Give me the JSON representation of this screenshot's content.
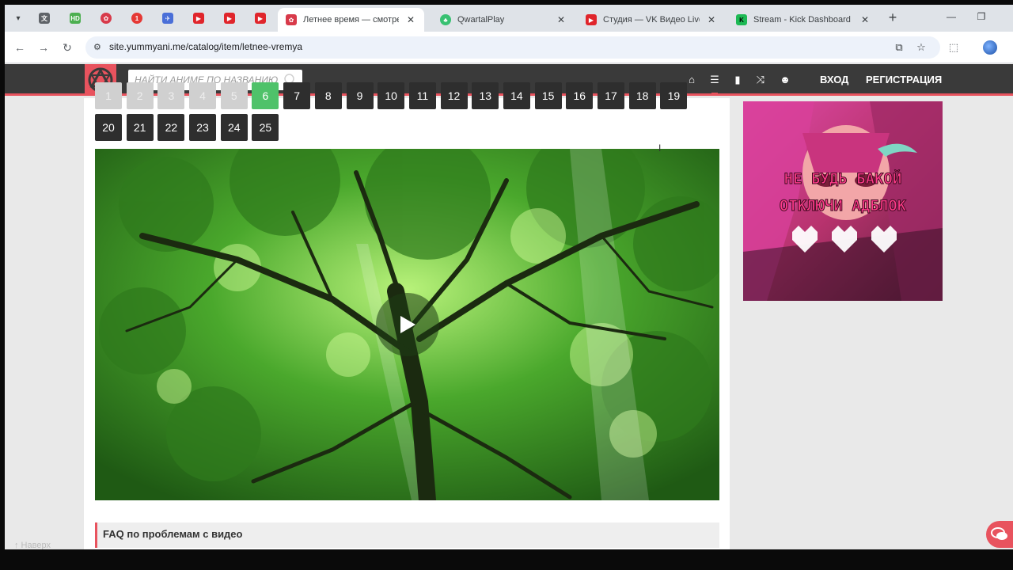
{
  "browser": {
    "pinned_tabs": [
      {
        "icon": "translate-icon",
        "color": "#5f6368"
      },
      {
        "icon": "hd-icon",
        "color": "#4caf50"
      },
      {
        "icon": "yummyanime-icon",
        "color": "#d83a4a"
      },
      {
        "icon": "badge-one-icon",
        "color": "#e53935"
      },
      {
        "icon": "bird-icon",
        "color": "#4a6fd8"
      },
      {
        "icon": "youtube-icon",
        "color": "#e0252b"
      },
      {
        "icon": "youtube-icon",
        "color": "#e0252b"
      },
      {
        "icon": "youtube-icon",
        "color": "#e0252b"
      }
    ],
    "tabs": [
      {
        "title": "Летнее время — смотреть аниме",
        "icon": "yummyanime-icon",
        "color": "#d83a4a",
        "active": true
      },
      {
        "title": "QwartalPlay",
        "icon": "clover-icon",
        "color": "#38c172",
        "active": false
      },
      {
        "title": "Студия — VK Видео Live",
        "icon": "vk-live-icon",
        "color": "#e0252b",
        "active": false
      },
      {
        "title": "Stream - Kick Dashboard",
        "icon": "kick-icon",
        "color": "#1db954",
        "active": false
      }
    ],
    "url": "site.yummyani.me/catalog/item/letnee-vremya"
  },
  "site": {
    "search_placeholder": "НАЙТИ АНИМЕ ПО НАЗВАНИЮ",
    "login_label": "ВХОД",
    "register_label": "РЕГИСТРАЦИЯ",
    "accent_color": "#e8535e",
    "episodes_row1": [
      "1",
      "2",
      "3",
      "4",
      "5",
      "6",
      "7",
      "8",
      "9",
      "10",
      "11",
      "12",
      "13",
      "14",
      "15",
      "16",
      "17",
      "18",
      "19"
    ],
    "episodes_row2": [
      "20",
      "21",
      "22",
      "23",
      "24",
      "25"
    ],
    "current_episode": "6",
    "faq_label": "FAQ по проблемам с видео",
    "to_top_label": "↑ Наверх",
    "ad_text_line1": "НЕ БУДЬ БАКОЙ",
    "ad_text_line2": "ОТКЛЮЧИ АДБЛОК"
  }
}
